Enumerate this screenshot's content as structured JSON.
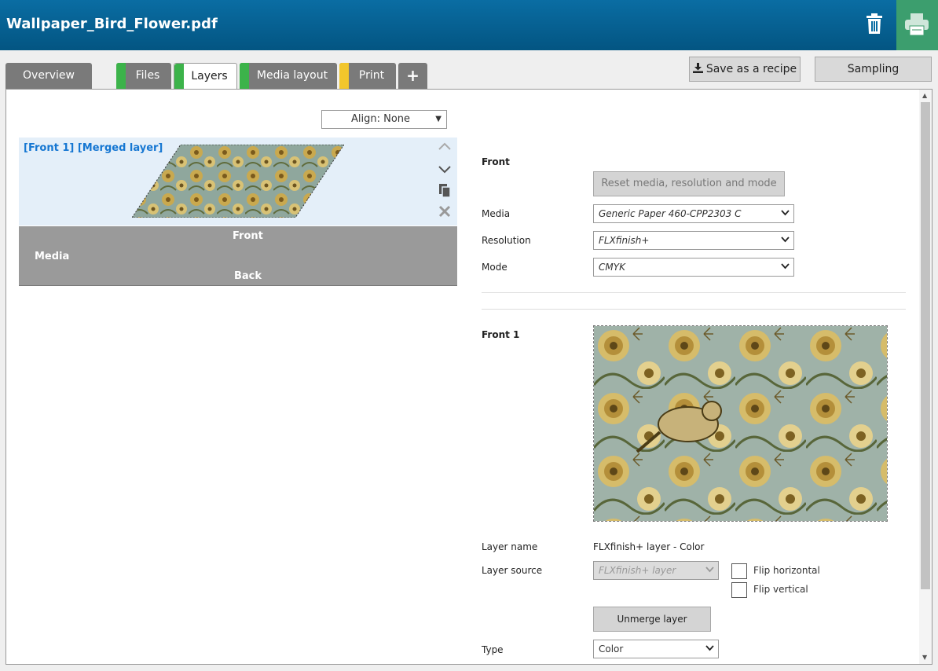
{
  "window": {
    "title": "Wallpaper_Bird_Flower.pdf"
  },
  "tabs": [
    {
      "label": "Overview",
      "status_color": ""
    },
    {
      "label": "Files",
      "status_color": "#3cb34a"
    },
    {
      "label": "Layers",
      "status_color": "#3cb34a"
    },
    {
      "label": "Media layout",
      "status_color": "#3cb34a"
    },
    {
      "label": "Print",
      "status_color": "#f2c62c"
    },
    {
      "label": "+"
    }
  ],
  "toolbar": {
    "save_recipe_label": "Save as a recipe",
    "sampling_label": "Sampling"
  },
  "layers_list": {
    "align_value": "Align: None",
    "layer_title": "[Front 1] [Merged layer]",
    "media_bar": {
      "front": "Front",
      "media": "Media",
      "back": "Back"
    }
  },
  "front_settings": {
    "heading": "Front",
    "reset_label": "Reset media, resolution and mode",
    "media_label": "Media",
    "media_value": "Generic Paper 460-CPP2303 C",
    "resolution_label": "Resolution",
    "resolution_value": "FLXfinish+",
    "mode_label": "Mode",
    "mode_value": "CMYK"
  },
  "layer_settings": {
    "heading": "Front 1",
    "layer_name_label": "Layer name",
    "layer_name_value": "FLXfinish+ layer - Color",
    "layer_source_label": "Layer source",
    "layer_source_value": "FLXfinish+ layer",
    "flip_horizontal_label": "Flip horizontal",
    "flip_vertical_label": "Flip vertical",
    "unmerge_label": "Unmerge layer",
    "type_label": "Type",
    "type_value": "Color"
  },
  "colors": {
    "titlebar": "#035582",
    "print_button": "#3c9e6e",
    "layer_title": "#1677d2"
  },
  "icons": [
    "trash-icon",
    "printer-icon",
    "download-icon",
    "chevron-up-icon",
    "chevron-down-icon",
    "copy-icon",
    "close-icon"
  ]
}
